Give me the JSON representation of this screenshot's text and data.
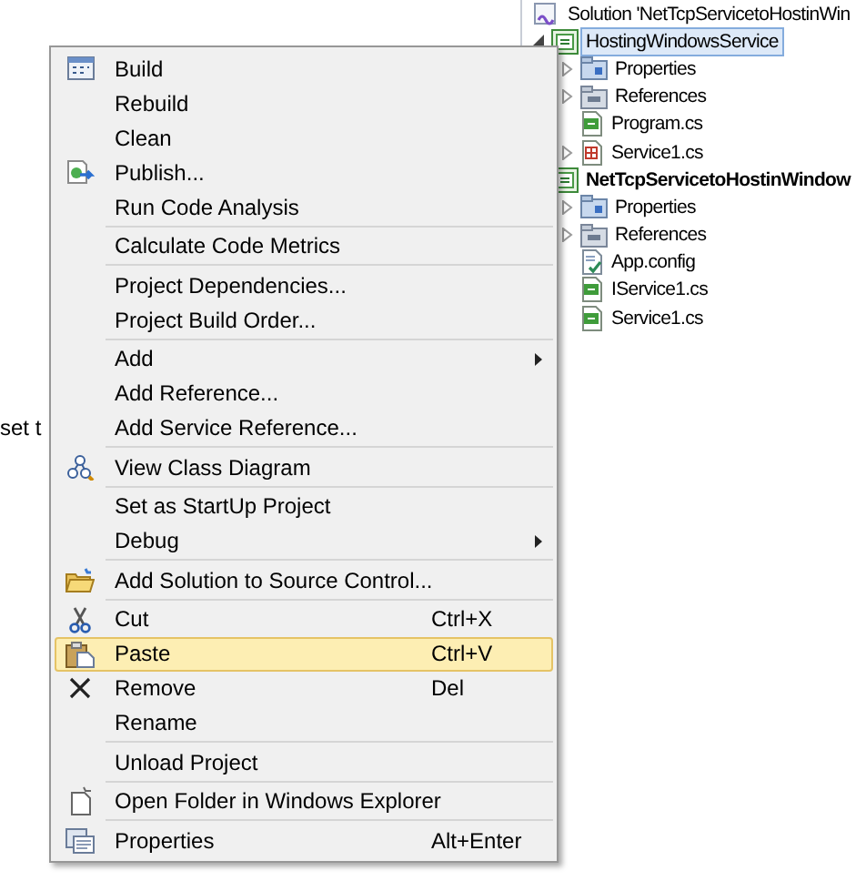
{
  "background_text": "set t",
  "solution_explorer": {
    "items": [
      {
        "label": "Solution 'NetTcpServicetoHostinWin",
        "kind": "solution",
        "selected": false,
        "children": [
          {
            "label": "HostingWindowsService",
            "kind": "project",
            "selected": true,
            "startup": false,
            "expanded": true,
            "children": [
              {
                "label": "Properties",
                "kind": "properties",
                "selected": false,
                "expanded": false
              },
              {
                "label": "References",
                "kind": "references",
                "selected": false,
                "expanded": false
              },
              {
                "label": "Program.cs",
                "kind": "cs",
                "selected": false
              },
              {
                "label": "Service1.cs",
                "kind": "service",
                "selected": false,
                "expanded": false
              }
            ]
          },
          {
            "label": "NetTcpServicetoHostinWindow",
            "kind": "project",
            "selected": false,
            "startup": true,
            "children": [
              {
                "label": "Properties",
                "kind": "properties",
                "selected": false,
                "expanded": false
              },
              {
                "label": "References",
                "kind": "references",
                "selected": false,
                "expanded": false
              },
              {
                "label": "App.config",
                "kind": "config",
                "selected": false
              },
              {
                "label": "IService1.cs",
                "kind": "cs",
                "selected": false
              },
              {
                "label": "Service1.cs",
                "kind": "cs",
                "selected": false
              }
            ]
          }
        ]
      }
    ]
  },
  "context_menu": {
    "items": [
      {
        "kind": "item",
        "label": "Build",
        "selected": false
      },
      {
        "kind": "item",
        "label": "Rebuild",
        "selected": false
      },
      {
        "kind": "item",
        "label": "Clean",
        "selected": false
      },
      {
        "kind": "item",
        "label": "Publish...",
        "selected": false
      },
      {
        "kind": "item",
        "label": "Run Code Analysis",
        "selected": false
      },
      {
        "kind": "separator"
      },
      {
        "kind": "item",
        "label": "Calculate Code Metrics",
        "selected": false
      },
      {
        "kind": "separator"
      },
      {
        "kind": "item",
        "label": "Project Dependencies...",
        "selected": false
      },
      {
        "kind": "item",
        "label": "Project Build Order...",
        "selected": false
      },
      {
        "kind": "separator"
      },
      {
        "kind": "item",
        "label": "Add",
        "submenu": true,
        "selected": false
      },
      {
        "kind": "item",
        "label": "Add Reference...",
        "selected": false
      },
      {
        "kind": "item",
        "label": "Add Service Reference...",
        "selected": false
      },
      {
        "kind": "separator"
      },
      {
        "kind": "item",
        "label": "View Class Diagram",
        "selected": false
      },
      {
        "kind": "separator"
      },
      {
        "kind": "item",
        "label": "Set as StartUp Project",
        "selected": false
      },
      {
        "kind": "item",
        "label": "Debug",
        "submenu": true,
        "selected": false
      },
      {
        "kind": "separator"
      },
      {
        "kind": "item",
        "label": "Add Solution to Source Control...",
        "selected": false
      },
      {
        "kind": "separator"
      },
      {
        "kind": "item",
        "label": "Cut",
        "shortcut": "Ctrl+X",
        "selected": false
      },
      {
        "kind": "item",
        "label": "Paste",
        "shortcut": "Ctrl+V",
        "selected": true
      },
      {
        "kind": "item",
        "label": "Remove",
        "shortcut": "Del",
        "selected": false
      },
      {
        "kind": "item",
        "label": "Rename",
        "selected": false
      },
      {
        "kind": "separator"
      },
      {
        "kind": "item",
        "label": "Unload Project",
        "selected": false
      },
      {
        "kind": "separator"
      },
      {
        "kind": "item",
        "label": "Open Folder in Windows Explorer",
        "selected": false
      },
      {
        "kind": "separator"
      },
      {
        "kind": "item",
        "label": "Properties",
        "shortcut": "Alt+Enter",
        "selected": false
      }
    ]
  }
}
